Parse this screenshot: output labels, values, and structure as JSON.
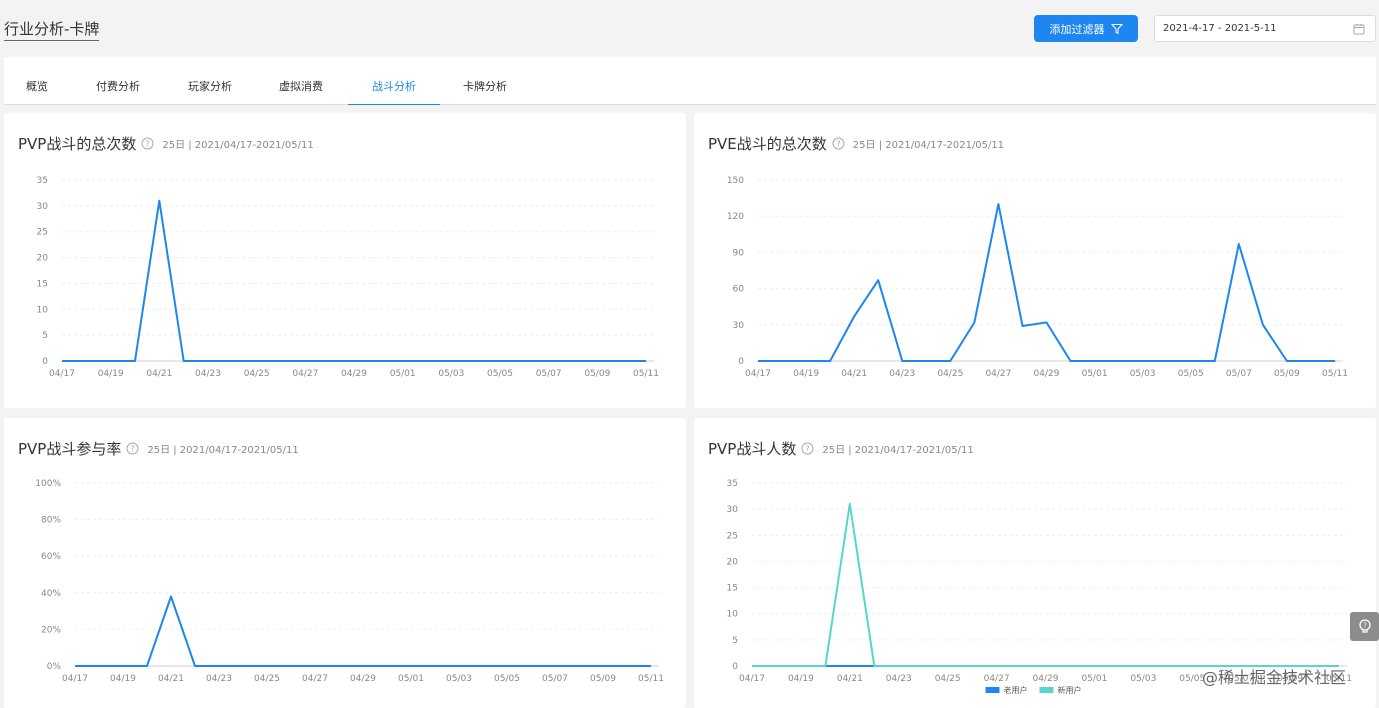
{
  "header": {
    "title": "行业分析-卡牌",
    "filter_button": "添加过滤器",
    "date_range": "2021-4-17 - 2021-5-11"
  },
  "tabs": [
    {
      "label": "概览",
      "active": false
    },
    {
      "label": "付费分析",
      "active": false
    },
    {
      "label": "玩家分析",
      "active": false
    },
    {
      "label": "虚拟消费",
      "active": false
    },
    {
      "label": "战斗分析",
      "active": true
    },
    {
      "label": "卡牌分析",
      "active": false
    }
  ],
  "watermark": "@稀土掘金技术社区",
  "colors": {
    "primary": "#1e86f0",
    "teal": "#56d6cc",
    "line_blue": "#1e86f0"
  },
  "chart_data": [
    {
      "type": "line",
      "title": "PVP战斗的总次数",
      "meta": "25日 | 2021/04/17-2021/05/11",
      "x": [
        "04/17",
        "04/18",
        "04/19",
        "04/20",
        "04/21",
        "04/22",
        "04/23",
        "04/24",
        "04/25",
        "04/26",
        "04/27",
        "04/28",
        "04/29",
        "04/30",
        "05/01",
        "05/02",
        "05/03",
        "05/04",
        "05/05",
        "05/06",
        "05/07",
        "05/08",
        "05/09",
        "05/10",
        "05/11"
      ],
      "x_tick_labels": [
        "04/17",
        "04/19",
        "04/21",
        "04/23",
        "04/25",
        "04/27",
        "04/29",
        "05/01",
        "05/03",
        "05/05",
        "05/07",
        "05/09",
        "05/11"
      ],
      "y_ticks": [
        "0",
        "5",
        "10",
        "15",
        "20",
        "25",
        "30",
        "35"
      ],
      "ylim": [
        0,
        35
      ],
      "series": [
        {
          "values": [
            0,
            0,
            0,
            0,
            31,
            0,
            0,
            0,
            0,
            0,
            0,
            0,
            0,
            0,
            0,
            0,
            0,
            0,
            0,
            0,
            0,
            0,
            0,
            0,
            0
          ],
          "color": "#1e86f0"
        }
      ]
    },
    {
      "type": "line",
      "title": "PVE战斗的总次数",
      "meta": "25日 | 2021/04/17-2021/05/11",
      "x": [
        "04/17",
        "04/18",
        "04/19",
        "04/20",
        "04/21",
        "04/22",
        "04/23",
        "04/24",
        "04/25",
        "04/26",
        "04/27",
        "04/28",
        "04/29",
        "04/30",
        "05/01",
        "05/02",
        "05/03",
        "05/04",
        "05/05",
        "05/06",
        "05/07",
        "05/08",
        "05/09",
        "05/10",
        "05/11"
      ],
      "x_tick_labels": [
        "04/17",
        "04/19",
        "04/21",
        "04/23",
        "04/25",
        "04/27",
        "04/29",
        "05/01",
        "05/03",
        "05/05",
        "05/07",
        "05/09",
        "05/11"
      ],
      "y_ticks": [
        "0",
        "30",
        "60",
        "90",
        "120",
        "150"
      ],
      "ylim": [
        0,
        150
      ],
      "series": [
        {
          "values": [
            0,
            0,
            0,
            0,
            37,
            67,
            0,
            0,
            0,
            32,
            130,
            29,
            32,
            0,
            0,
            0,
            0,
            0,
            0,
            0,
            97,
            30,
            0,
            0,
            0
          ],
          "color": "#1e86f0"
        }
      ]
    },
    {
      "type": "line",
      "title": "PVP战斗参与率",
      "meta": "25日 | 2021/04/17-2021/05/11",
      "x": [
        "04/17",
        "04/18",
        "04/19",
        "04/20",
        "04/21",
        "04/22",
        "04/23",
        "04/24",
        "04/25",
        "04/26",
        "04/27",
        "04/28",
        "04/29",
        "04/30",
        "05/01",
        "05/02",
        "05/03",
        "05/04",
        "05/05",
        "05/06",
        "05/07",
        "05/08",
        "05/09",
        "05/10",
        "05/11"
      ],
      "x_tick_labels": [
        "04/17",
        "04/19",
        "04/21",
        "04/23",
        "04/25",
        "04/27",
        "04/29",
        "05/01",
        "05/03",
        "05/05",
        "05/07",
        "05/09",
        "05/11"
      ],
      "y_ticks": [
        "0%",
        "20%",
        "40%",
        "60%",
        "80%",
        "100%"
      ],
      "ylim": [
        0,
        100
      ],
      "series": [
        {
          "values": [
            0,
            0,
            0,
            0,
            38,
            0,
            0,
            0,
            0,
            0,
            0,
            0,
            0,
            0,
            0,
            0,
            0,
            0,
            0,
            0,
            0,
            0,
            0,
            0,
            0
          ],
          "color": "#1e86f0"
        }
      ]
    },
    {
      "type": "line",
      "title": "PVP战斗人数",
      "meta": "25日 | 2021/04/17-2021/05/11",
      "x": [
        "04/17",
        "04/18",
        "04/19",
        "04/20",
        "04/21",
        "04/22",
        "04/23",
        "04/24",
        "04/25",
        "04/26",
        "04/27",
        "04/28",
        "04/29",
        "04/30",
        "05/01",
        "05/02",
        "05/03",
        "05/04",
        "05/05",
        "05/06",
        "05/07",
        "05/08",
        "05/09",
        "05/10",
        "05/11"
      ],
      "x_tick_labels": [
        "04/17",
        "04/19",
        "04/21",
        "04/23",
        "04/25",
        "04/27",
        "04/29",
        "05/01",
        "05/03",
        "05/05",
        "05/07",
        "05/09",
        "05/11"
      ],
      "y_ticks": [
        "0",
        "5",
        "10",
        "15",
        "20",
        "25",
        "30",
        "35"
      ],
      "ylim": [
        0,
        35
      ],
      "legend": "bottom",
      "series": [
        {
          "name": "老用户",
          "values": [
            0,
            0,
            0,
            0,
            0,
            0,
            0,
            0,
            0,
            0,
            0,
            0,
            0,
            0,
            0,
            0,
            0,
            0,
            0,
            0,
            0,
            0,
            0,
            0,
            0
          ],
          "color": "#1e86f0"
        },
        {
          "name": "新用户",
          "values": [
            0,
            0,
            0,
            0,
            31,
            0,
            0,
            0,
            0,
            0,
            0,
            0,
            0,
            0,
            0,
            0,
            0,
            0,
            0,
            0,
            0,
            0,
            0,
            0,
            0
          ],
          "color": "#56d6cc"
        }
      ]
    }
  ]
}
